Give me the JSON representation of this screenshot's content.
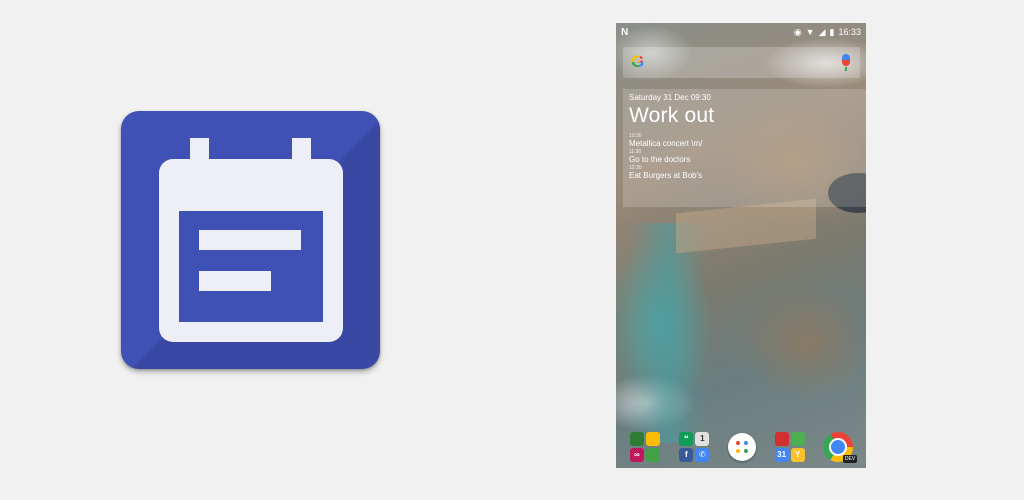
{
  "phone": {
    "status": {
      "left_icon": "N",
      "time": "16:33"
    },
    "widget": {
      "date": "Saturday 31 Dec 09:30",
      "title": "Work out",
      "events": [
        {
          "time": "10:30",
          "name": "Metallica concert \\m/"
        },
        {
          "time": "11:30",
          "name": "Go to the doctors"
        },
        {
          "time": "12:30",
          "name": "Eat Burgers at Bob's"
        }
      ]
    },
    "search": {
      "logo": "G"
    },
    "dock": {
      "folder1": [
        "",
        "",
        "∞",
        ""
      ],
      "folder2": [
        "❝",
        "1",
        "f",
        "✆"
      ],
      "folder3": [
        "",
        "",
        "31",
        "Y"
      ],
      "chrome_badge": "DEV"
    }
  },
  "colors": {
    "icon_bg": "#3f51b5",
    "icon_fg": "#eeeff6",
    "page_bg": "#f1f1f1"
  }
}
